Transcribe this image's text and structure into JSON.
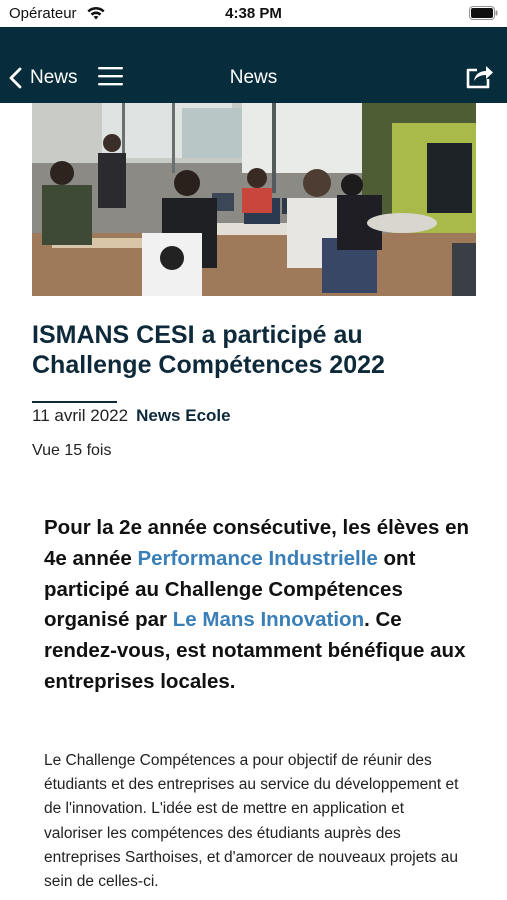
{
  "status_bar": {
    "carrier": "Opérateur",
    "time": "4:38 PM"
  },
  "nav": {
    "back_label": "News",
    "title": "News",
    "icons": [
      "chevron-left-icon",
      "menu-icon",
      "share-icon"
    ]
  },
  "article": {
    "title": "ISMANS CESI a participé au Challenge Compétences 2022",
    "date": "11 avril 2022",
    "category": "News Ecole",
    "views": "Vue 15 fois",
    "lead": {
      "part1": "Pour la 2e année consécutive, les élèves en 4e année ",
      "link1": "Performance Industrielle",
      "part2": " ont participé au Challenge Compétences organisé par ",
      "link2": "Le Mans Innovation",
      "part3": ". Ce rendez-vous, est notamment bénéfique aux entreprises locales."
    },
    "body": "Le Challenge Compétences a pour objectif de réunir des étudiants et des entreprises au service du développement et de l'innovation. L'idée est de mettre en application et valoriser les compétences des étudiants auprès des entreprises Sarthoises, et d'amorcer de nouveaux projets au sein de celles-ci."
  },
  "colors": {
    "nav_background": "#072d3c",
    "title_color": "#0e2a3a",
    "link_color": "#3a7fb8"
  }
}
